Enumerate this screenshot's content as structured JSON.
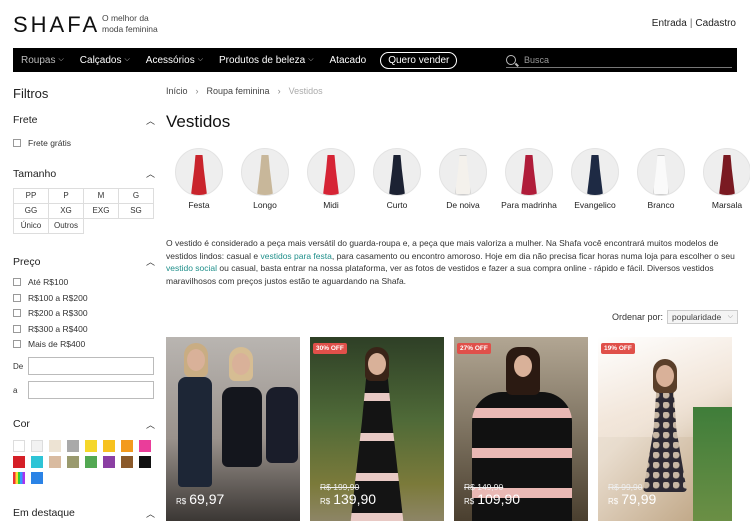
{
  "header": {
    "logo": "SHAFA",
    "tagline": "O melhor da moda feminina",
    "login": "Entrada",
    "separator": "|",
    "register": "Cadastro"
  },
  "nav": {
    "items": [
      {
        "label": "Roupas",
        "has_dropdown": true,
        "muted": true
      },
      {
        "label": "Calçados",
        "has_dropdown": true
      },
      {
        "label": "Acessórios",
        "has_dropdown": true
      },
      {
        "label": "Produtos de beleza",
        "has_dropdown": true
      },
      {
        "label": "Atacado",
        "has_dropdown": false
      }
    ],
    "sell_button": "Quero vender",
    "search_placeholder": "Busca"
  },
  "sidebar": {
    "title": "Filtros",
    "shipping": {
      "title": "Frete",
      "options": [
        "Frete grátis"
      ]
    },
    "size": {
      "title": "Tamanho",
      "options": [
        "PP",
        "P",
        "M",
        "G",
        "GG",
        "XG",
        "EXG",
        "SG",
        "Único",
        "Outros"
      ]
    },
    "price": {
      "title": "Preço",
      "options": [
        "Até R$100",
        "R$100 a R$200",
        "R$200 a R$300",
        "R$300 a R$400",
        "Mais de R$400"
      ],
      "from_label": "De",
      "to_label": "a"
    },
    "color": {
      "title": "Cor",
      "swatches": [
        "#ffffff",
        "#f2f2f2",
        "#ede3d3",
        "#a9a9a9",
        "#f5d72a",
        "#f7c21f",
        "#f39a1e",
        "#ea3d9a",
        "#d51f27",
        "#2ec4d6",
        "#d9bba0",
        "#9a9a6e",
        "#52a852",
        "#8b3fa3",
        "#8b5a2b",
        "#111111",
        "multicolor",
        "#2b83e6"
      ]
    },
    "featured": {
      "title": "Em destaque"
    }
  },
  "breadcrumb": {
    "items": [
      "Início",
      "Roupa feminina"
    ],
    "current": "Vestidos"
  },
  "page_title": "Vestidos",
  "categories": [
    {
      "label": "Festa",
      "color": "#c9242c"
    },
    {
      "label": "Longo",
      "color": "#c8b79a"
    },
    {
      "label": "Midi",
      "color": "#d62435"
    },
    {
      "label": "Curto",
      "color": "#1c2233"
    },
    {
      "label": "De noiva",
      "color": "#f4f1ec"
    },
    {
      "label": "Para madrinha",
      "color": "#b01d3a"
    },
    {
      "label": "Evangelico",
      "color": "#1e2a44"
    },
    {
      "label": "Branco",
      "color": "#fafafa"
    },
    {
      "label": "Marsala",
      "color": "#7a1a22"
    }
  ],
  "description": {
    "p1": "O vestido é considerado a peça mais versátil do guarda-roupa e, a peça que mais valoriza a mulher. Na Shafa você encontrará muitos modelos de vestidos lindos: casual e ",
    "link1": "vestidos para festa",
    "p2": ", para casamento ou encontro amoroso. Hoje em dia não precisa ficar horas numa loja para escolher o seu ",
    "link2": "vestido social",
    "p3": " ou casual, basta entrar na nossa plataforma, ver as fotos de vestidos e fazer a sua compra online - rápido e fácil. Diversos vestidos maravilhosos com preços justos estão te aguardando na Shafa."
  },
  "sort": {
    "label": "Ordenar por:",
    "value": "popularidade"
  },
  "products": [
    {
      "badge": "",
      "old_price": "",
      "currency": "R$",
      "price": "69,97"
    },
    {
      "badge": "30% OFF",
      "old_price": "R$ 199,90",
      "currency": "R$",
      "price": "139,90"
    },
    {
      "badge": "27% OFF",
      "old_price": "R$ 149,90",
      "currency": "R$",
      "price": "109,90"
    },
    {
      "badge": "19% OFF",
      "old_price": "R$ 99,90",
      "currency": "R$",
      "price": "79,99"
    }
  ]
}
